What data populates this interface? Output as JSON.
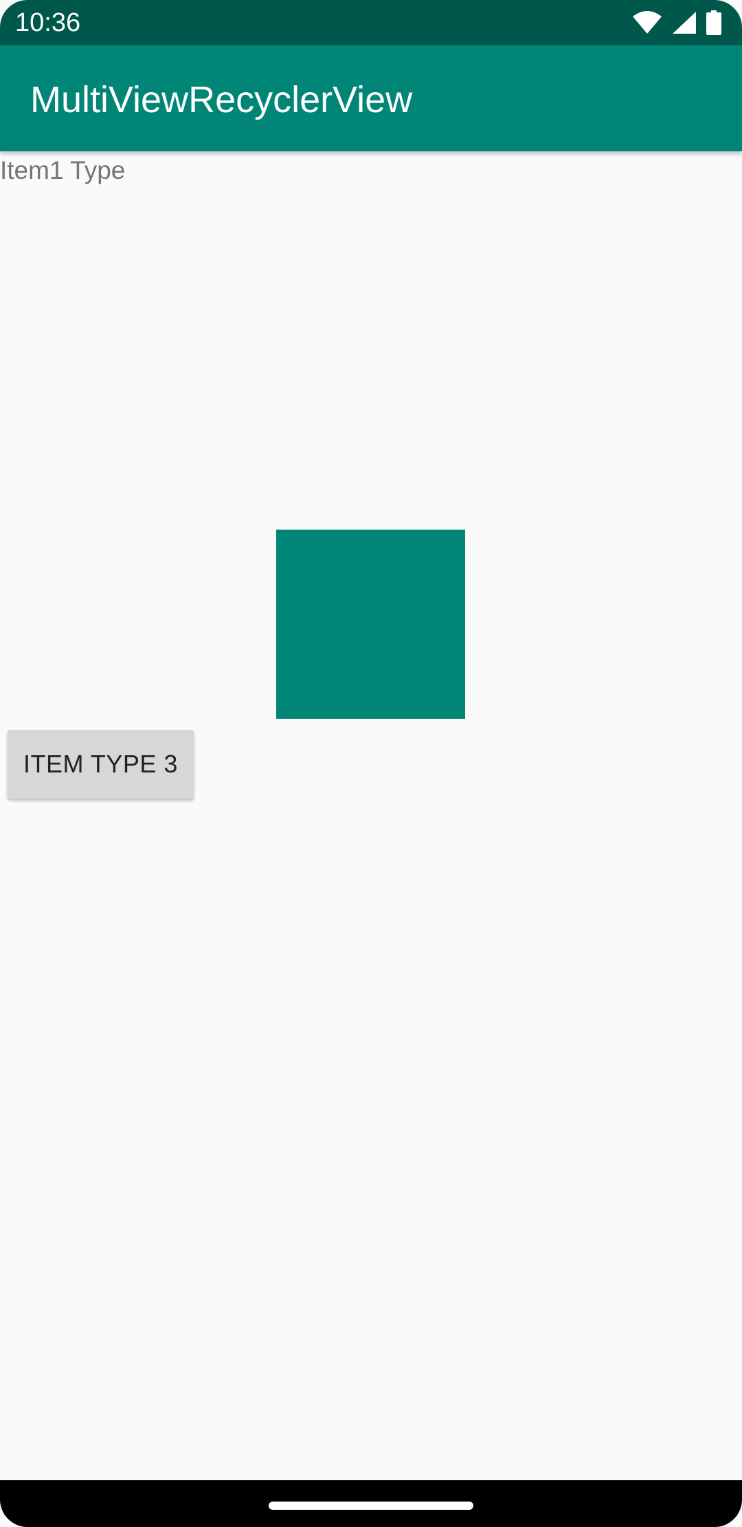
{
  "status_bar": {
    "time": "10:36",
    "icons": [
      "wifi-icon",
      "signal-icon",
      "battery-icon"
    ]
  },
  "app_bar": {
    "title": "MultiViewRecyclerView"
  },
  "list": {
    "item1_text": "Item1 Type",
    "item2_image": "grid-image",
    "item3_button_label": "ITEM TYPE 3"
  },
  "colors": {
    "status_bar": "#00574b",
    "app_bar": "#008577",
    "background": "#fafafa",
    "button": "#d6d7d7"
  }
}
